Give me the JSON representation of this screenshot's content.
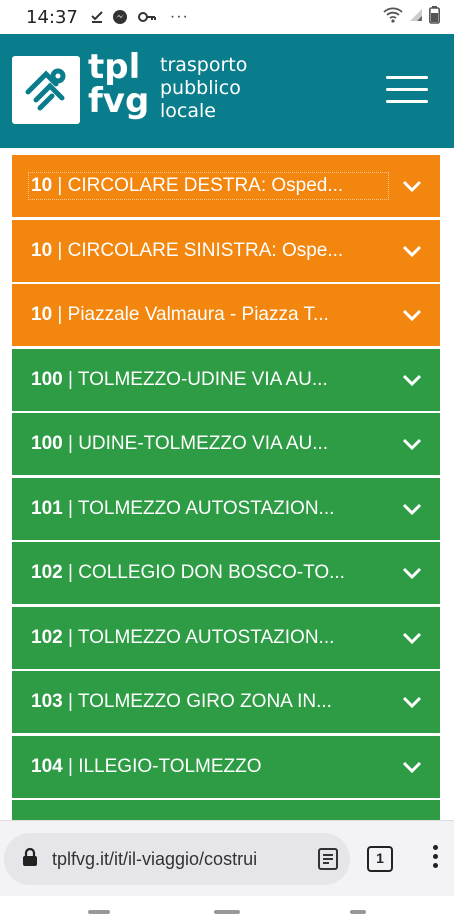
{
  "status": {
    "time": "14:37",
    "more": "···"
  },
  "header": {
    "brand": "tpl\nfvg",
    "brand_line1": "tpl",
    "brand_line2": "fvg",
    "subtitle_line1": "trasporto",
    "subtitle_line2": "pubblico",
    "subtitle_line3": "locale",
    "color": "#0a7d8c"
  },
  "lines": [
    {
      "number": "10",
      "name": "CIRCOLARE DESTRA: Osped...",
      "color": "orange"
    },
    {
      "number": "10",
      "name": "CIRCOLARE SINISTRA: Ospe...",
      "color": "orange"
    },
    {
      "number": "10",
      "name": "Piazzale Valmaura - Piazza T...",
      "color": "orange"
    },
    {
      "number": "100",
      "name": "TOLMEZZO-UDINE VIA AU...",
      "color": "green"
    },
    {
      "number": "100",
      "name": "UDINE-TOLMEZZO VIA AU...",
      "color": "green"
    },
    {
      "number": "101",
      "name": "TOLMEZZO AUTOSTAZION...",
      "color": "green"
    },
    {
      "number": "102",
      "name": "COLLEGIO DON BOSCO-TO...",
      "color": "green"
    },
    {
      "number": "102",
      "name": "TOLMEZZO AUTOSTAZION...",
      "color": "green"
    },
    {
      "number": "103",
      "name": "TOLMEZZO GIRO ZONA IN...",
      "color": "green"
    },
    {
      "number": "104",
      "name": "ILLEGIO-TOLMEZZO",
      "color": "green"
    },
    {
      "number": "",
      "name": "",
      "color": "green"
    }
  ],
  "colors": {
    "orange": "#f2860e",
    "green": "#2e9c45"
  },
  "browser": {
    "url": "tplfvg.it/it/il-viaggio/costrui",
    "tab_count": "1"
  },
  "icons": [
    "download-done-icon",
    "messenger-icon",
    "key-icon",
    "wifi-icon",
    "signal-icon",
    "battery-icon",
    "lock-icon",
    "reader-mode-icon",
    "chevron-down-icon",
    "hamburger-menu-icon"
  ]
}
